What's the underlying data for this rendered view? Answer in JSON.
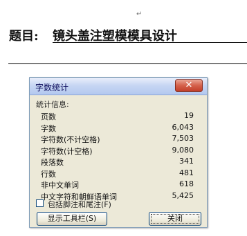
{
  "document": {
    "paragraph_mark": "↵",
    "title_label": "题目:",
    "title_value": "镜头盖注塑模模具设计"
  },
  "dialog": {
    "title": "字数统计",
    "close_glyph": "✕",
    "section_label": "统计信息:",
    "stats": [
      {
        "label": "页数",
        "value": "19"
      },
      {
        "label": "字数",
        "value": "6,043"
      },
      {
        "label": "字符数(不计空格)",
        "value": "7,503"
      },
      {
        "label": "字符数(计空格)",
        "value": "9,080"
      },
      {
        "label": "段落数",
        "value": "341"
      },
      {
        "label": "行数",
        "value": "481"
      },
      {
        "label": "非中文单词",
        "value": "618"
      },
      {
        "label": "中文字符和朝鲜语单词",
        "value": "5,425"
      }
    ],
    "include_footnotes_label": "包括脚注和尾注(F)",
    "show_toolbar_button": "显示工具栏(S)",
    "close_button": "关闭"
  }
}
